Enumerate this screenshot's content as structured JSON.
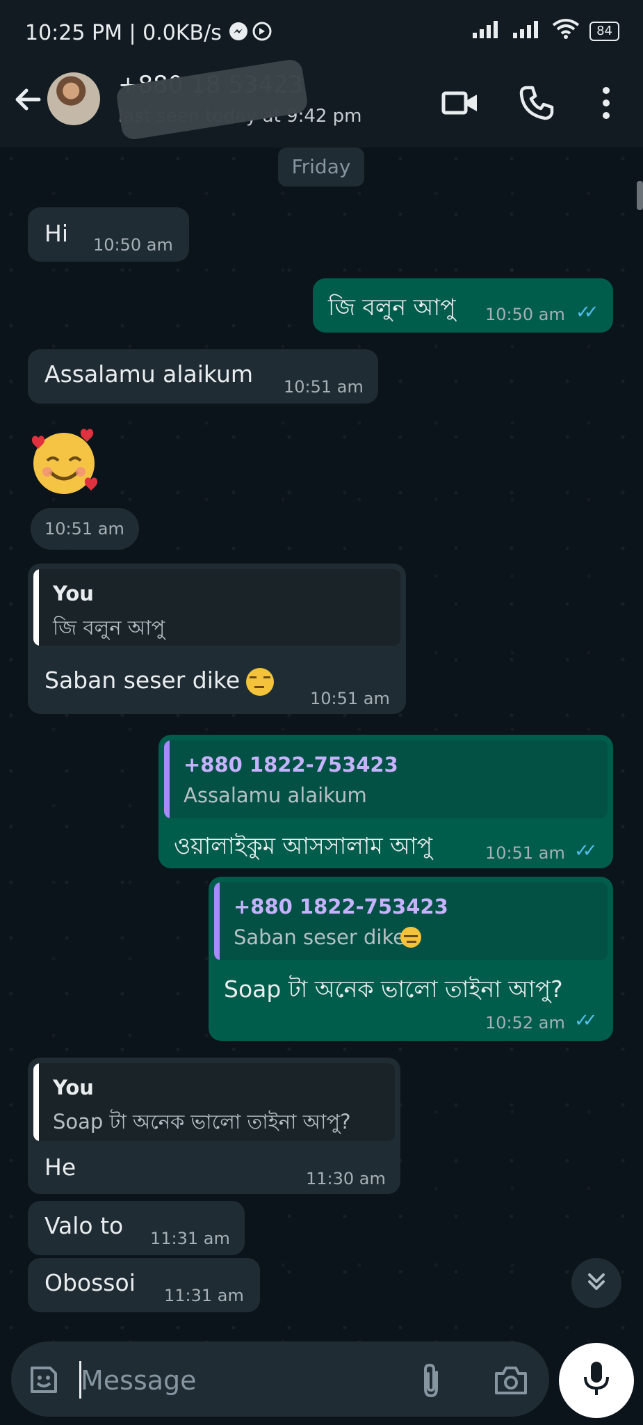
{
  "status_bar": {
    "time_speed": "10:25 PM | 0.0KB/s",
    "battery": "84"
  },
  "header": {
    "contact_name": "+880 18   53423",
    "last_seen": "last seen today at 9:42 pm"
  },
  "chat": {
    "date_divider": "Friday",
    "messages": [
      {
        "text": "Hi",
        "time": "10:50 am"
      },
      {
        "text": "জি বলুন আপু",
        "time": "10:50 am"
      },
      {
        "text": "Assalamu alaikum",
        "time": "10:51 am"
      },
      {
        "time": "10:51 am"
      },
      {
        "quote_author": "You",
        "quote_text": "জি বলুন আপু",
        "text": "Saban seser dike",
        "time": "10:51 am"
      },
      {
        "quote_author": "+880 1822-753423",
        "quote_text": "Assalamu alaikum",
        "text": "ওয়ালাইকুম আসসালাম আপু",
        "time": "10:51 am"
      },
      {
        "quote_author": "+880 1822-753423",
        "quote_text": "Saban seser dike",
        "text": "Soap টা অনেক ভালো তাইনা আপু?",
        "time": "10:52 am"
      },
      {
        "quote_author": "You",
        "quote_text": "Soap টা অনেক ভালো তাইনা আপু?",
        "text": "He",
        "time": "11:30 am"
      },
      {
        "text": "Valo to",
        "time": "11:31 am"
      },
      {
        "text": "Obossoi",
        "time": "11:31 am"
      }
    ]
  },
  "input": {
    "placeholder": "Message"
  },
  "colors": {
    "background": "#0b141a",
    "incoming_bubble": "#202c33",
    "outgoing_bubble": "#005c4b",
    "read_ticks": "#53bdeb",
    "quote_you_bar": "#ffffff",
    "quote_contact_bar": "#a78bfa"
  },
  "icons": [
    "back-arrow-icon",
    "video-call-icon",
    "voice-call-icon",
    "more-options-icon",
    "sticker-icon",
    "attach-icon",
    "camera-icon",
    "mic-icon",
    "scroll-down-icon",
    "double-check-icon"
  ]
}
